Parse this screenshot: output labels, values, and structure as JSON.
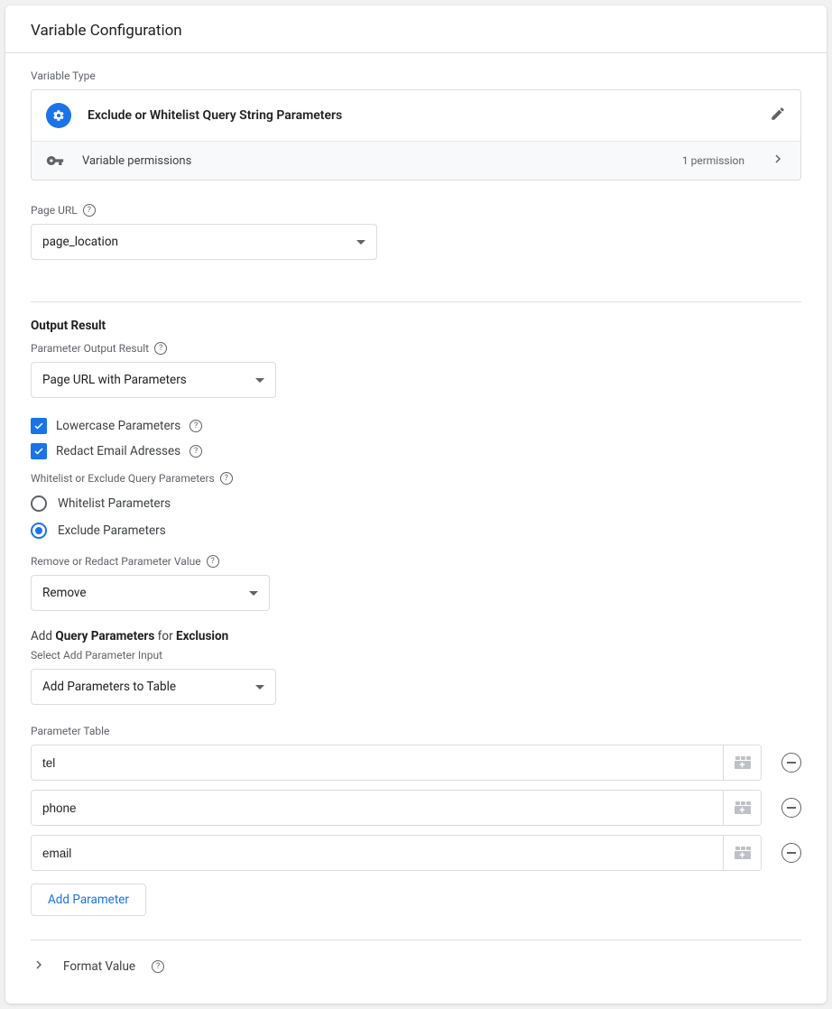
{
  "header": {
    "title": "Variable Configuration"
  },
  "variableType": {
    "label": "Variable Type",
    "name": "Exclude or Whitelist Query String Parameters"
  },
  "permissions": {
    "label": "Variable permissions",
    "count": "1 permission"
  },
  "pageUrl": {
    "label": "Page URL",
    "value": "page_location"
  },
  "output": {
    "title": "Output Result",
    "paramLabel": "Parameter Output Result",
    "paramValue": "Page URL with Parameters",
    "lowercaseLabel": "Lowercase Parameters",
    "redactLabel": "Redact Email Adresses"
  },
  "mode": {
    "label": "Whitelist or Exclude Query Parameters",
    "whitelist": "Whitelist Parameters",
    "exclude": "Exclude Parameters"
  },
  "removeRedact": {
    "label": "Remove or Redact Parameter Value",
    "value": "Remove"
  },
  "addParams": {
    "prefix": "Add",
    "bold1": "Query Parameters",
    "middle": "for",
    "bold2": "Exclusion",
    "subLabel": "Select Add Parameter Input",
    "value": "Add Parameters to Table"
  },
  "paramTable": {
    "label": "Parameter Table",
    "rows": [
      "tel",
      "phone",
      "email"
    ],
    "addButton": "Add Parameter"
  },
  "formatValue": {
    "label": "Format Value"
  }
}
